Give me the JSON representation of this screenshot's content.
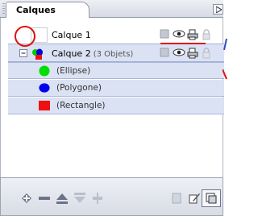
{
  "panel": {
    "tab_title": "Calques"
  },
  "layers": [
    {
      "name": "Calque 1",
      "sub": ""
    },
    {
      "name": "Calque 2",
      "sub": "(3 Objets)"
    }
  ],
  "objects": [
    {
      "name": "(Ellipse)",
      "color": "#00dd00",
      "shape": "circle"
    },
    {
      "name": "(Polygone)",
      "color": "#0000ee",
      "shape": "ellipse"
    },
    {
      "name": "(Rectangle)",
      "color": "#ee1111",
      "shape": "square"
    }
  ],
  "row_icons": [
    "layer-box-icon",
    "eye-icon",
    "print-icon",
    "lock-icon"
  ],
  "bottom_toolbar": [
    "add-layer-icon",
    "remove-icon",
    "move-up-icon",
    "move-down-icon",
    "merge-icon",
    "layer-options-icon",
    "edit-icon",
    "layers-view-icon"
  ],
  "colors": {
    "selection": "#dbe2f3",
    "highlight": "#e01010"
  }
}
